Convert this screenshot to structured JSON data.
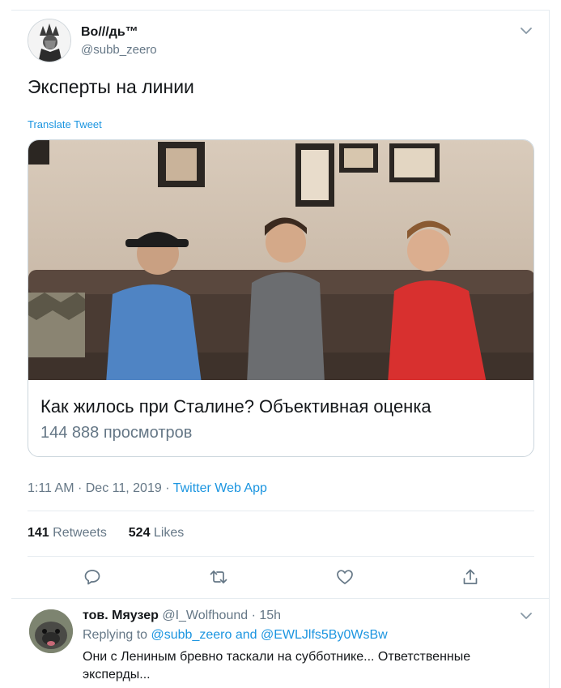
{
  "tweet": {
    "author_name": "Во///дь™",
    "author_handle": "@subb_zeero",
    "text": "Эксперты на линии",
    "translate_label": "Translate Tweet",
    "card": {
      "title": "Как жилось при Сталине? Объективная оценка",
      "views": "144 888 просмотров"
    },
    "time": "1:11 AM",
    "date": "Dec 11, 2019",
    "source": "Twitter Web App",
    "retweets_count": "141",
    "retweets_label": "Retweets",
    "likes_count": "524",
    "likes_label": "Likes",
    "actions": [
      "reply-icon",
      "retweet-icon",
      "like-icon",
      "share-icon"
    ]
  },
  "reply": {
    "author_name": "тов. Мяузер",
    "author_handle": "@I_Wolfhound",
    "age": "15h",
    "replying_prefix": "Replying to",
    "replying_user1": "@subb_zeero",
    "replying_and": "and",
    "replying_user2": "@EWLJlfs5By0WsBw",
    "text": "Они с Лениным бревно таскали на субботнике... Ответственные эксперды..."
  },
  "colors": {
    "link": "#1b95e0",
    "secondary_text": "#657786",
    "primary_text": "#14171a",
    "border": "#e6ecf0"
  }
}
